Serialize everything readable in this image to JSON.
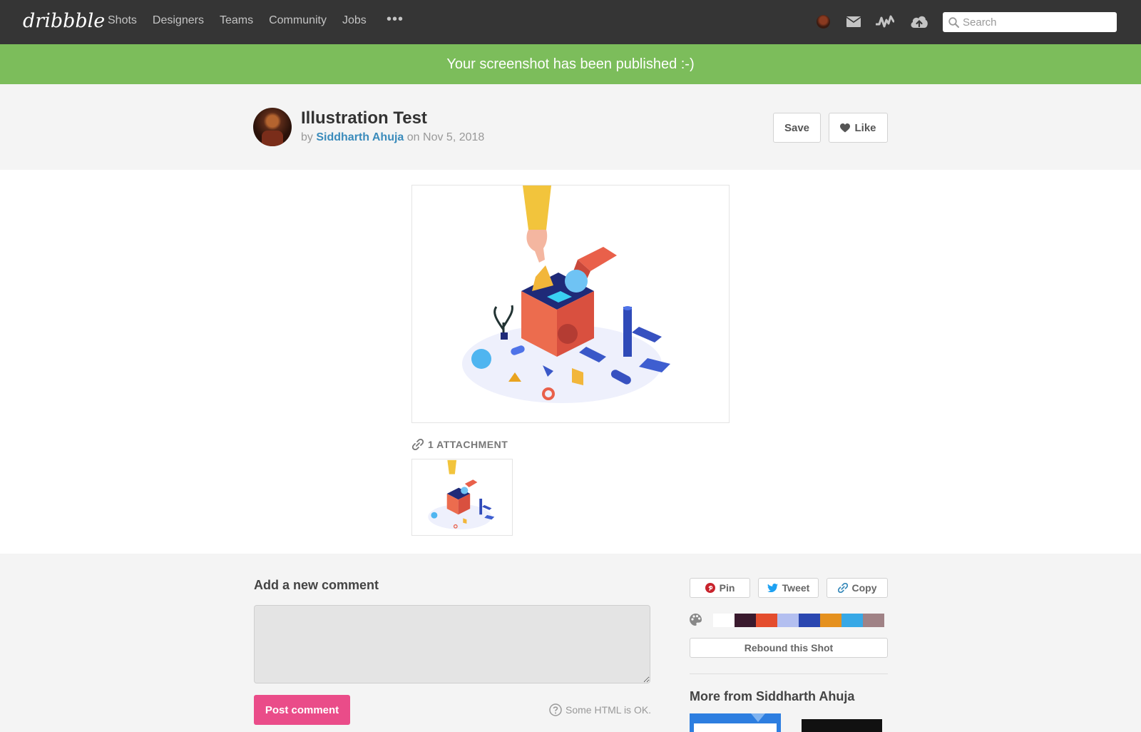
{
  "nav": {
    "logo": "dribbble",
    "links": [
      "Shots",
      "Designers",
      "Teams",
      "Community",
      "Jobs"
    ],
    "more": "•••",
    "search_placeholder": "Search"
  },
  "banner": {
    "message": "Your screenshot has been published :-)"
  },
  "shot": {
    "title": "Illustration Test",
    "by": "by",
    "author": "Siddharth Ahuja",
    "on": "on",
    "date": "Nov 5, 2018",
    "save_label": "Save",
    "like_label": "Like"
  },
  "attachments": {
    "label": "1 ATTACHMENT"
  },
  "comments": {
    "title": "Add a new comment",
    "post_label": "Post comment",
    "hint": "Some HTML is OK."
  },
  "share": {
    "pin": "Pin",
    "tweet": "Tweet",
    "copy": "Copy"
  },
  "palette": [
    "#ffffff",
    "#3a1a2e",
    "#e44d2e",
    "#b3bff0",
    "#2b47b0",
    "#e5911f",
    "#37a8e6",
    "#a08286"
  ],
  "rebound_label": "Rebound this Shot",
  "more_from": {
    "title": "More from Siddharth Ahuja"
  },
  "colors": {
    "nav_bg": "#353535",
    "banner_bg": "#7cbd5b",
    "accent_pink": "#ea4c89",
    "link_blue": "#3a8bbb"
  }
}
